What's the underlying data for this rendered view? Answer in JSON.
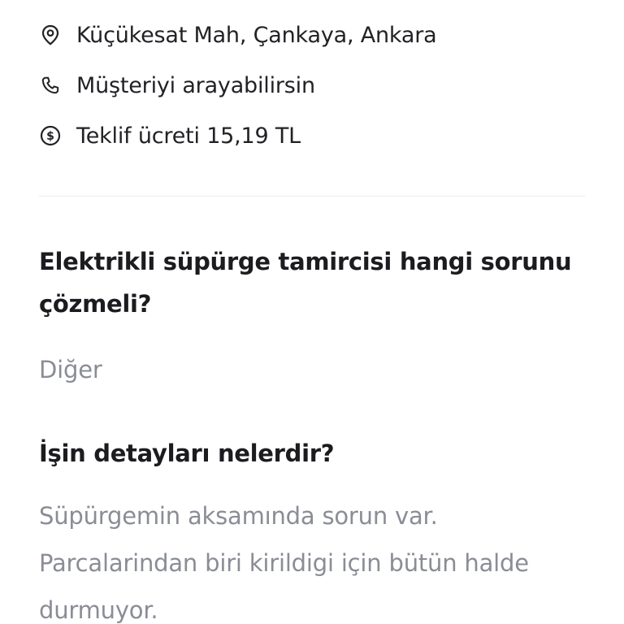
{
  "job_info": {
    "location": "Küçükesat Mah, Çankaya, Ankara",
    "phone_note": "Müşteriyi arayabilirsin",
    "offer_fee": "Teklif ücreti 15,19 TL"
  },
  "questions": [
    {
      "question": "Elektrikli süpürge tamircisi hangi sorunu çözmeli?",
      "answer": "Diğer"
    },
    {
      "question": "İşin detayları nelerdir?",
      "answer": "Süpürgemin aksamında sorun var. Parcalarindan biri kirildigi için bütün halde durmuyor."
    }
  ],
  "icons": {
    "location": "location-pin-icon",
    "phone": "phone-icon",
    "fee": "dollar-circle-icon"
  },
  "colors": {
    "text_primary": "#1c1c20",
    "text_secondary": "#8a8d95",
    "divider": "#ececee"
  }
}
